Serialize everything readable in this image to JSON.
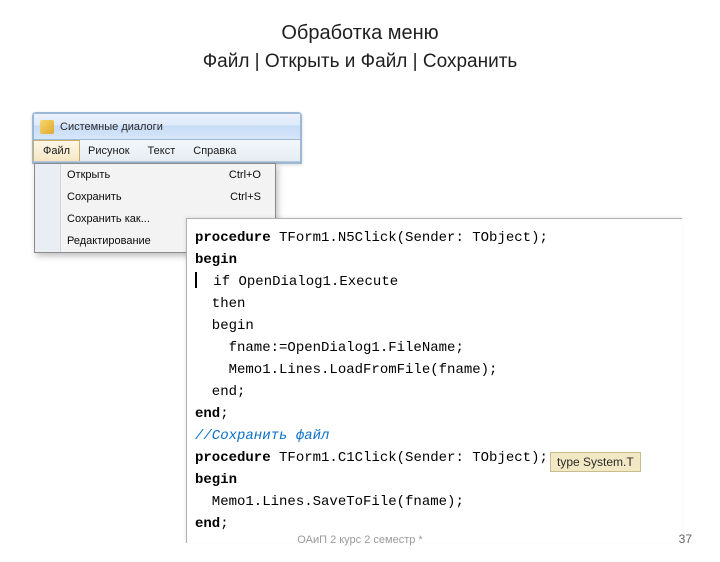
{
  "title": "Обработка меню",
  "subtitle": "Файл | Открыть   и   Файл | Сохранить",
  "window": {
    "title": "Системные диалоги",
    "menubar": [
      "Файл",
      "Рисунок",
      "Текст",
      "Справка"
    ],
    "open_index": 0,
    "dropdown": [
      {
        "label": "Открыть",
        "shortcut": "Ctrl+O"
      },
      {
        "label": "Сохранить",
        "shortcut": "Ctrl+S"
      },
      {
        "label": "Сохранить как...",
        "shortcut": ""
      },
      {
        "label": "Редактирование",
        "shortcut": ""
      }
    ]
  },
  "code": {
    "lines": [
      {
        "kw": "procedure",
        "rest": " TForm1.N5Click(Sender: TObject);"
      },
      {
        "kw": "begin",
        "rest": ""
      },
      {
        "cursor": true,
        "rest": "  if OpenDialog1.Execute"
      },
      {
        "rest": "  then"
      },
      {
        "rest": "  begin"
      },
      {
        "rest": "    fname:=OpenDialog1.FileName;"
      },
      {
        "rest": "    Memo1.Lines.LoadFromFile(fname);"
      },
      {
        "rest": "  end;"
      },
      {
        "kw": "end",
        "rest": ";"
      },
      {
        "comment": "//Сохранить файл"
      },
      {
        "kw": "procedure",
        "rest": " TForm1.C1Click(Sender: TObject);"
      },
      {
        "kw": "begin",
        "rest": ""
      },
      {
        "rest": "  Memo1.Lines.SaveToFile(fname);"
      },
      {
        "kw": "end",
        "rest": ";"
      }
    ]
  },
  "tooltip": "type System.T",
  "footer_center": "ОАиП 2 курс 2 семестр    *",
  "footer_right": "37"
}
